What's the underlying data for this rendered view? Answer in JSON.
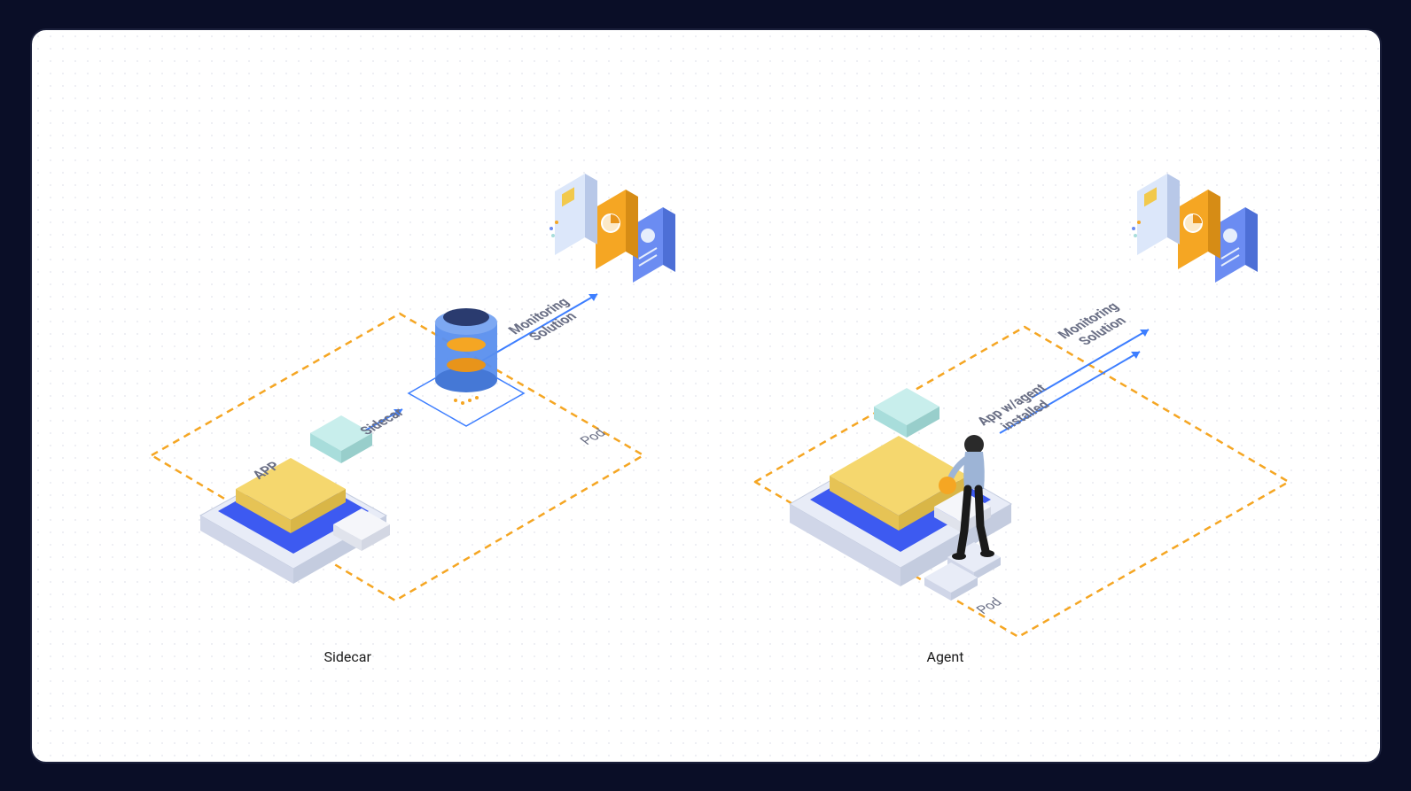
{
  "diagrams": {
    "left": {
      "title": "Sidecar",
      "pod_label": "Pod",
      "app_label": "APP",
      "sidecar_label": "Sidecar",
      "monitoring_label_line1": "Monitoring",
      "monitoring_label_line2": "Solution"
    },
    "right": {
      "title": "Agent",
      "pod_label": "Pod",
      "app_label_line1": "App w/agent",
      "app_label_line2": "installed",
      "monitoring_label_line1": "Monitoring",
      "monitoring_label_line2": "Solution"
    }
  },
  "colors": {
    "pod_border": "#f5a623",
    "arrow": "#3d7eff",
    "app_yellow": "#f2c94c",
    "platform_blue": "#3d5af1",
    "cyan_block": "#b4e7e4",
    "text_muted": "#6a6f85"
  }
}
